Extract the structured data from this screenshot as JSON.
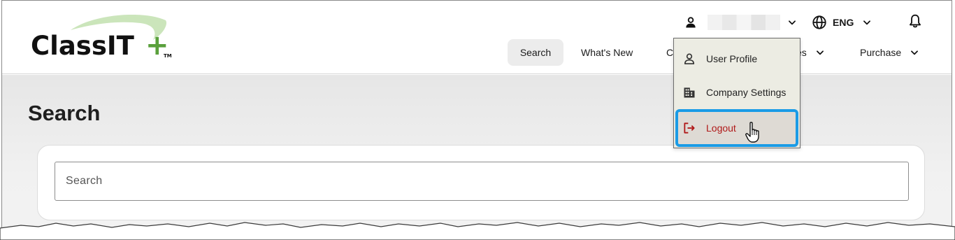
{
  "brand": {
    "logo_text": "ClassIT",
    "logo_plus": "+",
    "logo_tm": "TM",
    "green": "#5aa03c"
  },
  "header": {
    "user_icon": "user-icon",
    "language_label": "ENG",
    "language_icon": "globe-icon",
    "notifications_icon": "bell-icon"
  },
  "nav": {
    "items": [
      {
        "label": "Search"
      },
      {
        "label": "What's New"
      },
      {
        "label": "C"
      },
      {
        "label": "es"
      },
      {
        "label": "Purchase"
      }
    ]
  },
  "page": {
    "title": "Search"
  },
  "search": {
    "placeholder": "Search"
  },
  "user_menu": {
    "items": [
      {
        "label": "User Profile",
        "icon": "user-icon"
      },
      {
        "label": "Company Settings",
        "icon": "building-icon"
      },
      {
        "label": "Logout",
        "icon": "logout-icon"
      }
    ]
  },
  "colors": {
    "accent": "#1a9be6",
    "logout": "#b01818"
  }
}
